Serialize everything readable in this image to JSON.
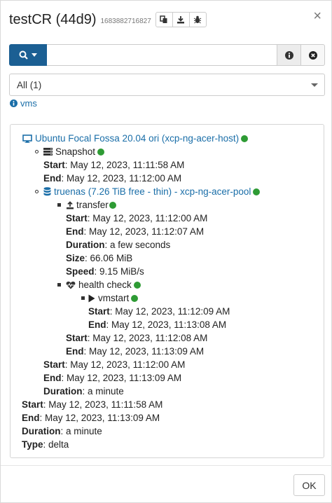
{
  "dialog": {
    "title": "testCR (44d9)",
    "id": "1683882716827",
    "close": "×"
  },
  "search": {
    "value": "",
    "placeholder": ""
  },
  "filter": {
    "selected": "All (1)"
  },
  "vms_link": "vms",
  "log": {
    "vm_name": "Ubuntu Focal Fossa 20.04 ori (xcp-ng-acer-host)",
    "snapshot": {
      "label": "Snapshot",
      "start_label": "Start",
      "start_value": ": May 12, 2023, 11:11:58 AM",
      "end_label": "End",
      "end_value": ": May 12, 2023, 11:12:00 AM"
    },
    "sr": {
      "label": "truenas (7.26 TiB free - thin) - xcp-ng-acer-pool",
      "transfer": {
        "label": "transfer",
        "start_label": "Start",
        "start_value": ": May 12, 2023, 11:12:00 AM",
        "end_label": "End",
        "end_value": ": May 12, 2023, 11:12:07 AM",
        "duration_label": "Duration",
        "duration_value": ": a few seconds",
        "size_label": "Size",
        "size_value": ": 66.06 MiB",
        "speed_label": "Speed",
        "speed_value": ": 9.15 MiB/s"
      },
      "health": {
        "label": "health check",
        "vmstart": {
          "label": "vmstart",
          "start_label": "Start",
          "start_value": ": May 12, 2023, 11:12:09 AM",
          "end_label": "End",
          "end_value": ": May 12, 2023, 11:13:08 AM"
        },
        "start_label": "Start",
        "start_value": ": May 12, 2023, 11:12:08 AM",
        "end_label": "End",
        "end_value": ": May 12, 2023, 11:13:09 AM"
      },
      "start_label": "Start",
      "start_value": ": May 12, 2023, 11:12:00 AM",
      "end_label": "End",
      "end_value": ": May 12, 2023, 11:13:09 AM",
      "duration_label": "Duration",
      "duration_value": ": a minute"
    },
    "start_label": "Start",
    "start_value": ": May 12, 2023, 11:11:58 AM",
    "end_label": "End",
    "end_value": ": May 12, 2023, 11:13:09 AM",
    "duration_label": "Duration",
    "duration_value": ": a minute",
    "type_label": "Type",
    "type_value": ": delta"
  },
  "footer": {
    "ok_label": "OK"
  },
  "colors": {
    "primary": "#1b5f93",
    "link": "#1a6ea8",
    "status_ok": "#2e9b34"
  },
  "icons": {
    "header": [
      "copy-icon",
      "download-icon",
      "bug-icon"
    ],
    "search": [
      "search-icon",
      "caret-down-icon"
    ],
    "search_right": [
      "info-icon",
      "clear-icon"
    ],
    "log": [
      "desktop-icon",
      "server-icon",
      "database-icon",
      "upload-icon",
      "heartbeat-icon",
      "play-icon"
    ]
  }
}
